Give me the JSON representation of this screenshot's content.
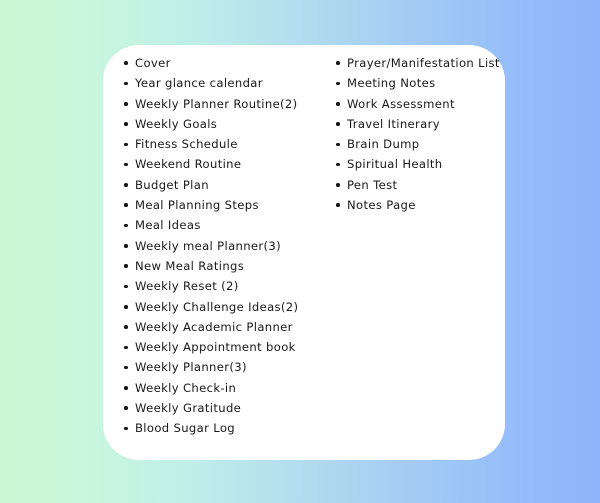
{
  "background": {
    "gradient_from": "#ccf9d4",
    "gradient_mid": "#b3dcee",
    "gradient_to": "#8eb4fb",
    "direction": "horizontal-left-to-right"
  },
  "card": {
    "background_color": "#ffffff",
    "corner_radius": "36px"
  },
  "text": {
    "color": "#191919",
    "bullet_color": "#141414"
  },
  "columns": {
    "left": {
      "items": [
        {
          "label": "Cover",
          "bullet": "bullet-icon"
        },
        {
          "label": "Year glance calendar",
          "bullet": "bullet-icon"
        },
        {
          "label": "Weekly Planner Routine(2)",
          "bullet": "bullet-icon"
        },
        {
          "label": "Weekly Goals",
          "bullet": "bullet-icon"
        },
        {
          "label": "Fitness Schedule",
          "bullet": "bullet-icon"
        },
        {
          "label": "Weekend Routine",
          "bullet": "bullet-icon"
        },
        {
          "label": "Budget Plan",
          "bullet": "bullet-icon"
        },
        {
          "label": "Meal Planning Steps",
          "bullet": "bullet-icon"
        },
        {
          "label": "Meal Ideas",
          "bullet": "bullet-icon"
        },
        {
          "label": "Weekly meal Planner(3)",
          "bullet": "bullet-icon"
        },
        {
          "label": "New Meal Ratings",
          "bullet": "bullet-icon"
        },
        {
          "label": "Weekly Reset (2)",
          "bullet": "bullet-icon"
        },
        {
          "label": "Weekly Challenge Ideas(2)",
          "bullet": "bullet-icon"
        },
        {
          "label": "Weekly Academic Planner",
          "bullet": "bullet-icon"
        },
        {
          "label": "Weekly Appointment book",
          "bullet": "bullet-icon"
        },
        {
          "label": "Weekly Planner(3)",
          "bullet": "bullet-icon"
        },
        {
          "label": "Weekly Check-in",
          "bullet": "bullet-icon"
        },
        {
          "label": "Weekly Gratitude",
          "bullet": "bullet-icon"
        },
        {
          "label": "Blood Sugar Log",
          "bullet": "bullet-icon"
        }
      ]
    },
    "right": {
      "items": [
        {
          "label": "Prayer/Manifestation List",
          "bullet": "bullet-icon"
        },
        {
          "label": "Meeting Notes",
          "bullet": "bullet-icon"
        },
        {
          "label": "Work Assessment",
          "bullet": "bullet-icon"
        },
        {
          "label": "Travel Itinerary",
          "bullet": "bullet-icon"
        },
        {
          "label": "Brain Dump",
          "bullet": "bullet-icon"
        },
        {
          "label": "Spiritual Health",
          "bullet": "bullet-icon"
        },
        {
          "label": "Pen Test",
          "bullet": "bullet-icon"
        },
        {
          "label": "Notes Page",
          "bullet": "bullet-icon"
        }
      ]
    }
  }
}
